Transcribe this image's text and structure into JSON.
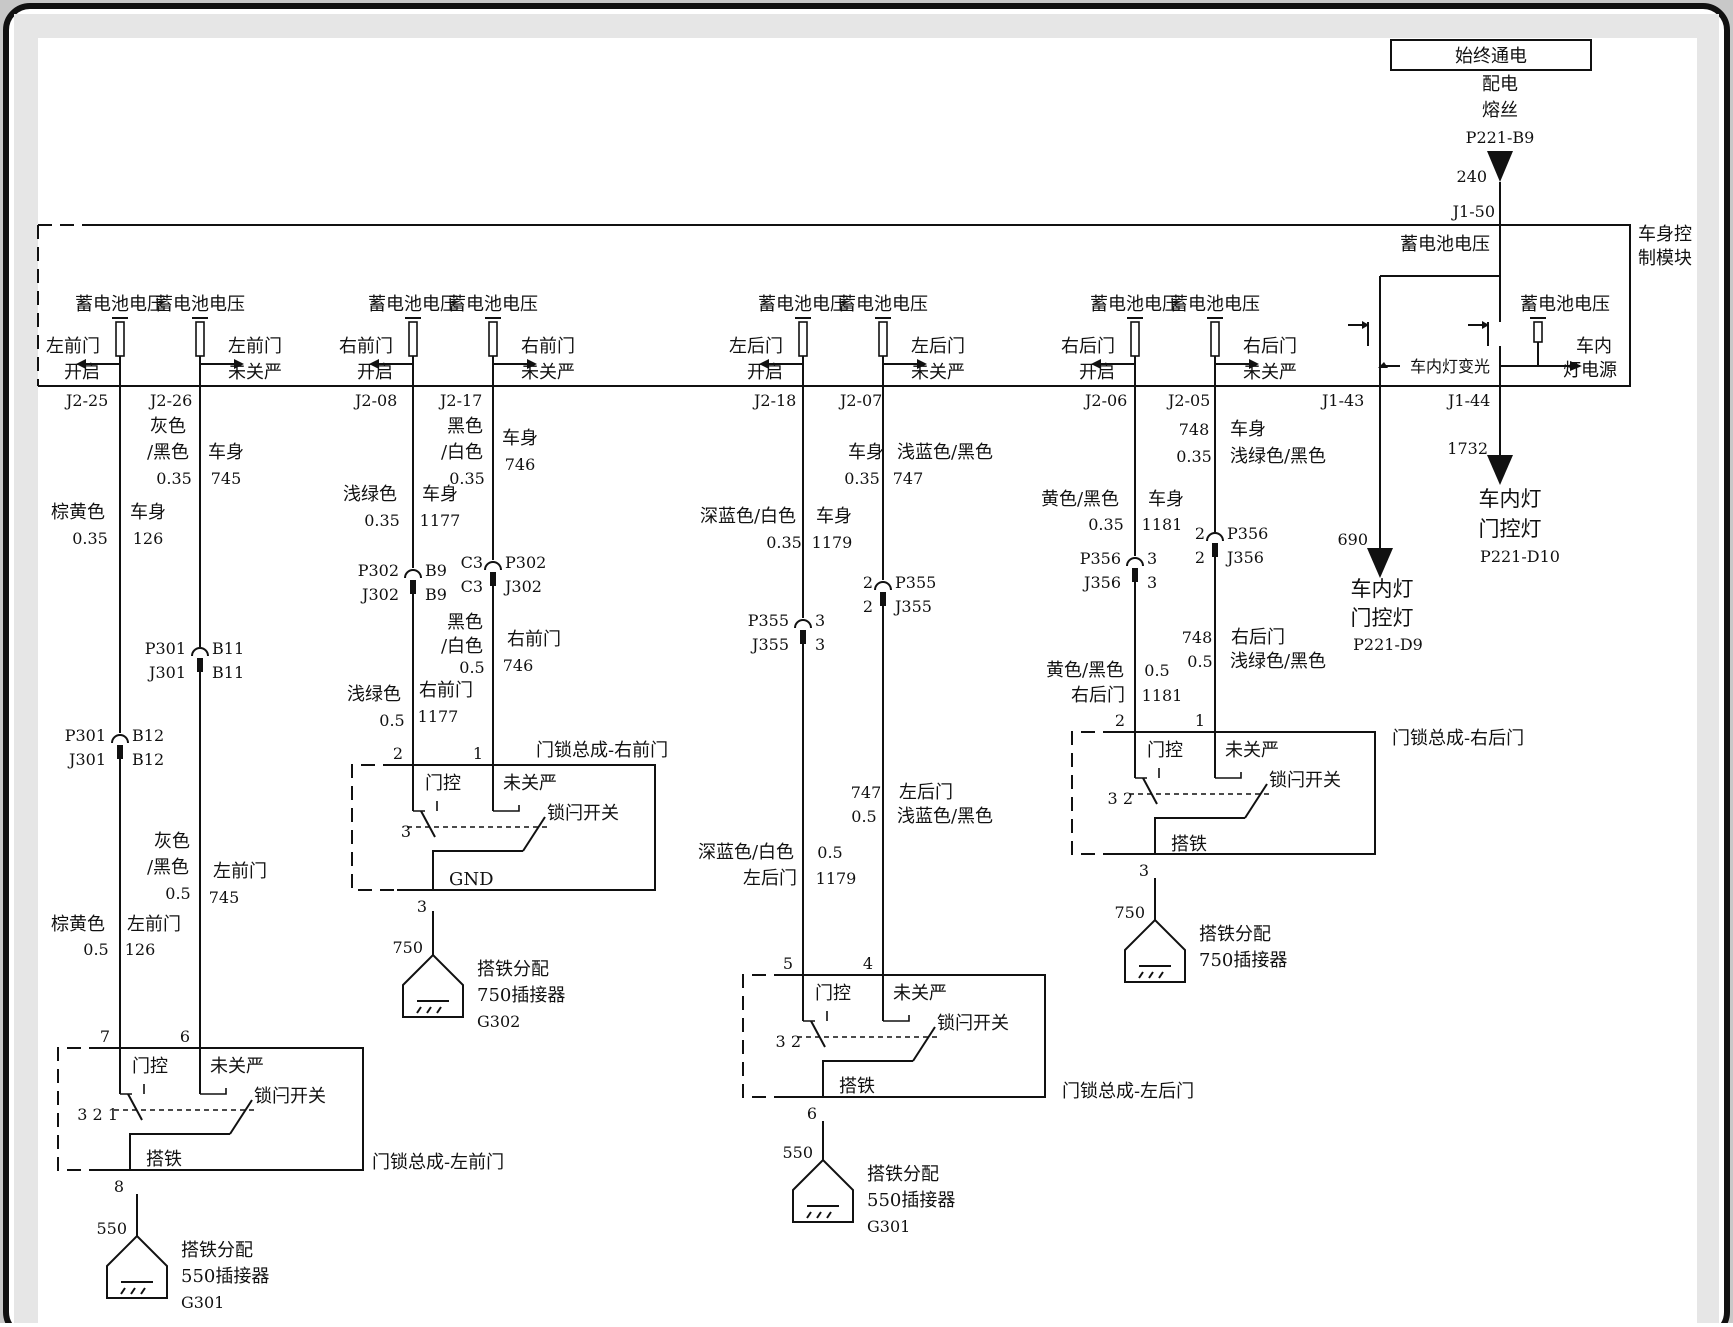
{
  "power": {
    "box_label": "始终通电",
    "fuse_line1": "配电",
    "fuse_line2": "熔丝",
    "fuse_id": "P221-B9",
    "wire_240": "240",
    "pin_j1_50": "J1-50"
  },
  "bcm": {
    "name_line1": "车身控",
    "name_line2": "制模块",
    "bat_voltage_top": "蓄电池电压",
    "dome_control": "车内灯变光",
    "dome_power_line1": "车内",
    "dome_power_line2": "灯电源",
    "bat_voltage_dome": "蓄电池电压"
  },
  "battery_labels": [
    "蓄电池电压",
    "蓄电池电压",
    "蓄电池电压",
    "蓄电池电压",
    "蓄电池电压",
    "蓄电池电压",
    "蓄电池电压",
    "蓄电池电压"
  ],
  "signals": [
    {
      "l1": "左前门",
      "l2": "开启"
    },
    {
      "l1": "左前门",
      "l2": "未关严"
    },
    {
      "l1": "右前门",
      "l2": "开启"
    },
    {
      "l1": "右前门",
      "l2": "未关严"
    },
    {
      "l1": "左后门",
      "l2": "开启"
    },
    {
      "l1": "左后门",
      "l2": "未关严"
    },
    {
      "l1": "右后门",
      "l2": "开启"
    },
    {
      "l1": "右后门",
      "l2": "未关严"
    }
  ],
  "pins": [
    "J2-25",
    "J2-26",
    "J2-08",
    "J2-17",
    "J2-18",
    "J2-07",
    "J2-06",
    "J2-05",
    "J1-43",
    "J1-44"
  ],
  "wires": {
    "w126a": {
      "color": "棕黄色",
      "size": "0.35",
      "loc": "车身",
      "num": "126"
    },
    "w745a": {
      "c1": "灰色",
      "c2": "/黑色",
      "size": "0.35",
      "loc": "车身",
      "num": "745"
    },
    "w126b": {
      "color": "棕黄色",
      "size": "0.5",
      "loc": "左前门",
      "num": "126"
    },
    "w745b": {
      "c1": "灰色",
      "c2": "/黑色",
      "size": "0.5",
      "loc": "左前门",
      "num": "745"
    },
    "w1177a": {
      "color": "浅绿色",
      "size": "0.35",
      "loc": "车身",
      "num": "1177"
    },
    "w746a": {
      "c1": "黑色",
      "c2": "/白色",
      "size": "0.35",
      "loc": "车身",
      "num": "746"
    },
    "w1177b": {
      "color": "浅绿色",
      "size": "0.5",
      "loc": "右前门",
      "num": "1177"
    },
    "w746b": {
      "c1": "黑色",
      "c2": "/白色",
      "size": "0.5",
      "loc": "右前门",
      "num": "746"
    },
    "w1179a": {
      "color": "深蓝色/白色",
      "size": "0.35",
      "loc": "车身",
      "num": "1179"
    },
    "w747a": {
      "color": "浅蓝色/黑色",
      "size": "0.35",
      "loc": "车身",
      "num": "747"
    },
    "w1179b": {
      "color": "深蓝色/白色",
      "size": "0.5",
      "loc": "左后门",
      "num": "1179"
    },
    "w747b": {
      "color": "浅蓝色/黑色",
      "size": "0.5",
      "loc": "左后门",
      "num": "747"
    },
    "w1181a": {
      "color": "黄色/黑色",
      "size": "0.35",
      "loc": "车身",
      "num": "1181"
    },
    "w748a": {
      "color": "浅绿色/黑色",
      "size": "0.35",
      "loc": "车身",
      "num": "748"
    },
    "w1181b": {
      "color": "黄色/黑色",
      "size": "0.5",
      "loc": "右后门",
      "num": "1181"
    },
    "w748b": {
      "color": "浅绿色/黑色",
      "size": "0.5",
      "loc": "右后门",
      "num": "748"
    },
    "w690": "690",
    "w1732": "1732"
  },
  "connectors": {
    "lf_j301": {
      "p": "P301",
      "j": "J301",
      "a": "B11",
      "b": "B11"
    },
    "lf_j301b": {
      "p": "P301",
      "j": "J301",
      "a": "B12",
      "b": "B12"
    },
    "rf_j302a": {
      "p": "P302",
      "j": "J302",
      "a": "B9",
      "b": "B9"
    },
    "rf_j302b": {
      "p": "P302",
      "j": "J302",
      "a": "C3",
      "b": "C3"
    },
    "lr_j355a": {
      "p": "P355",
      "j": "J355",
      "a": "3",
      "b": "3"
    },
    "lr_j355b": {
      "p": "P355",
      "j": "J355",
      "a": "2",
      "b": "2"
    },
    "rr_j356a": {
      "p": "P356",
      "j": "J356",
      "a": "3",
      "b": "3"
    },
    "rr_j356b": {
      "p": "P356",
      "j": "J356",
      "a": "2",
      "b": "2"
    }
  },
  "locks": {
    "lf": {
      "title": "门锁总成-左前门",
      "sw_open": "门控",
      "sw_ajar": "未关严",
      "sw_name": "锁闩开关",
      "gnd": "搭铁",
      "pin_a": "7",
      "pin_b": "6",
      "pin_g": "8",
      "nums": "3 2 1"
    },
    "rf": {
      "title": "门锁总成-右前门",
      "sw_open": "门控",
      "sw_ajar": "未关严",
      "sw_name": "锁闩开关",
      "gnd": "GND",
      "pin_a": "2",
      "pin_b": "1",
      "pin_g": "3",
      "nums": "3"
    },
    "lr": {
      "title": "门锁总成-左后门",
      "sw_open": "门控",
      "sw_ajar": "未关严",
      "sw_name": "锁闩开关",
      "gnd": "搭铁",
      "pin_a": "5",
      "pin_b": "4",
      "pin_g": "6",
      "nums": "3 2"
    },
    "rr": {
      "title": "门锁总成-右后门",
      "sw_open": "门控",
      "sw_ajar": "未关严",
      "sw_name": "锁闩开关",
      "gnd": "搭铁",
      "pin_a": "2",
      "pin_b": "1",
      "pin_g": "3",
      "nums": "3 2"
    }
  },
  "grounds": {
    "g_lf": {
      "wire": "550",
      "l1": "搭铁分配",
      "l2": "550插接器",
      "l3": "G301"
    },
    "g_rf": {
      "wire": "750",
      "l1": "搭铁分配",
      "l2": "750插接器",
      "l3": "G302"
    },
    "g_lr": {
      "wire": "550",
      "l1": "搭铁分配",
      "l2": "550插接器",
      "l3": "G301"
    },
    "g_rr": {
      "wire": "750",
      "l1": "搭铁分配",
      "l2": "750插接器",
      "l3": ""
    }
  },
  "dome_lamps": {
    "a": {
      "l1": "车内灯",
      "l2": "门控灯",
      "l3": "P221-D9"
    },
    "b": {
      "l1": "车内灯",
      "l2": "门控灯",
      "l3": "P221-D10"
    }
  }
}
